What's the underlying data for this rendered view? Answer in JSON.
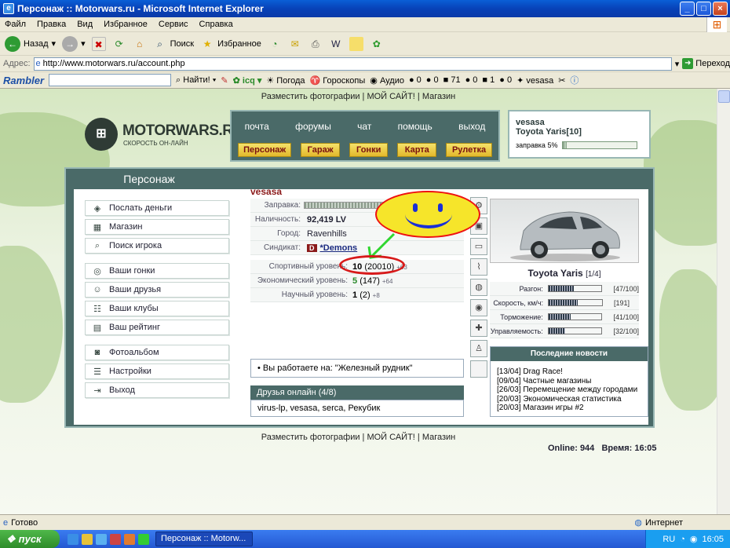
{
  "window": {
    "title": "Персонаж :: Motorwars.ru - Microsoft Internet Explorer",
    "min": "_",
    "max": "□",
    "close": "×"
  },
  "menubar": [
    "Файл",
    "Правка",
    "Вид",
    "Избранное",
    "Сервис",
    "Справка"
  ],
  "toolbar": {
    "back": "Назад",
    "search": "Поиск",
    "favorites": "Избранное"
  },
  "address": {
    "label": "Адрес:",
    "url": "http://www.motorwars.ru/account.php",
    "go": "Переход"
  },
  "rambler": {
    "brand": "Rambler",
    "find": "Найти!",
    "icq": "icq",
    "weather": "Погода",
    "horoscope": "Гороскопы",
    "audio": "Аудио",
    "c1": "0",
    "c2": "0",
    "c3": "71",
    "c4": "0",
    "c5": "1",
    "c6": "0",
    "user": "vesasa"
  },
  "site": {
    "toplinks": "Разместить фотографии | МОЙ САЙТ! | Магазин",
    "logo": {
      "name": "MOTORWARS.RU",
      "tagline": "СКОРОСТЬ ОН-ЛАЙН"
    },
    "nav": [
      "почта",
      "форумы",
      "чат",
      "помощь",
      "выход"
    ],
    "navbuttons": [
      "Персонаж",
      "Гараж",
      "Гонки",
      "Карта",
      "Рулетка"
    ],
    "user": {
      "name": "vesasa",
      "car": "Toyota Yaris[10]",
      "fuel_label": "заправка 5%",
      "fuel": 0.05
    },
    "tab": "Персонаж",
    "menu": [
      "Послать деньги",
      "Магазин",
      "Поиск игрока",
      "Ваши гонки",
      "Ваши друзья",
      "Ваши клубы",
      "Ваш рейтинг",
      "Фотоальбом",
      "Настройки",
      "Выход"
    ],
    "char": {
      "name": "vesasa",
      "fuel_label": "Заправка:",
      "cash_label": "Наличность:",
      "cash": "92,419 LV",
      "city_label": "Город:",
      "city": "Ravenhills",
      "syndicate_label": "Синдикат:",
      "syndicate": "*Demons"
    },
    "levels": [
      {
        "label": "Спортивный уровень:",
        "value": "10",
        "extra": "(20010)",
        "bonus": "+63"
      },
      {
        "label": "Экономический уровень:",
        "value": "5",
        "extra": "(147)",
        "bonus": "+64"
      },
      {
        "label": "Научный уровень:",
        "value": "1",
        "extra": "(2)",
        "bonus": "+8"
      }
    ],
    "work": "Вы работаете на: \"Железный рудник\"",
    "friends": {
      "title": "Друзья онлайн (4/8)",
      "list": "virus-lp, vesasa, serca, Рекубик"
    },
    "car": {
      "name": "Toyota Yaris",
      "sub": "[1/4]",
      "stats": [
        {
          "label": "Разгон:",
          "value": "[47/100]",
          "frac": 0.47
        },
        {
          "label": "Скорость, км/ч:",
          "value": "[191]",
          "frac": 0.55
        },
        {
          "label": "Торможение:",
          "value": "[41/100]",
          "frac": 0.41
        },
        {
          "label": "Управляемость:",
          "value": "[32/100]",
          "frac": 0.32
        }
      ]
    },
    "news": {
      "title": "Последние новости",
      "items": [
        "[13/04] Drag Race!",
        "[09/04] Частные магазины",
        "[26/03] Перемещение между городами",
        "[20/03] Экономическая статистика",
        "[20/03] Магазин игры #2"
      ]
    },
    "bottomlinks": "Разместить фотографии | МОЙ САЙТ! | Магазин",
    "online": "Online: 944   Время: 16:05"
  },
  "status": {
    "text": "Готово",
    "zone": "Интернет"
  },
  "taskbar": {
    "start": "пуск",
    "item": "Персонаж :: Motorw...",
    "lang": "RU",
    "clock": "16:05"
  }
}
